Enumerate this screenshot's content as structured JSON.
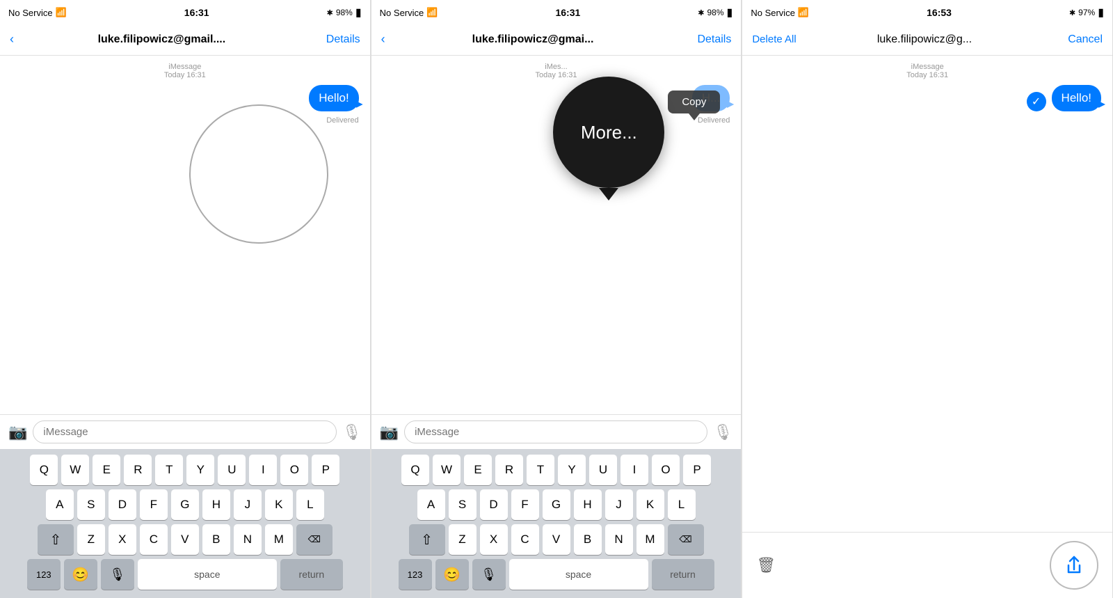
{
  "panels": [
    {
      "id": "panel1",
      "statusBar": {
        "left": "No Service",
        "wifiIcon": "📶",
        "center": "16:31",
        "bluetoothIcon": "🔷",
        "battery": "98%",
        "batteryIcon": "▮"
      },
      "navBar": {
        "backLabel": "‹",
        "titleLabel": "luke.filipowicz@gmail....",
        "actionLabel": "Details"
      },
      "messageArea": {
        "timestampLabel": "iMessage",
        "timestampSub": "Today 16:31",
        "bubbleText": "Hello!",
        "deliveredText": "Delivered"
      },
      "inputBar": {
        "placeholder": "iMessage"
      },
      "keyboard": {
        "rows": [
          [
            "Q",
            "W",
            "E",
            "R",
            "T",
            "Y",
            "U",
            "I",
            "O",
            "P"
          ],
          [
            "A",
            "S",
            "D",
            "F",
            "G",
            "H",
            "J",
            "K",
            "L"
          ],
          [
            "⇧",
            "Z",
            "X",
            "C",
            "V",
            "B",
            "N",
            "M",
            "⌫"
          ],
          [
            "123",
            "😊",
            "🎙",
            "space",
            "return"
          ]
        ]
      }
    },
    {
      "id": "panel2",
      "statusBar": {
        "left": "No Service",
        "wifiIcon": "📶",
        "center": "16:31",
        "bluetoothIcon": "🔷",
        "battery": "98%",
        "batteryIcon": "▮"
      },
      "navBar": {
        "backLabel": "‹",
        "titleLabel": "luke.filipowicz@gmai...",
        "actionLabel": "Details"
      },
      "messageArea": {
        "timestampLabel": "iMes...",
        "timestampSub": "Today 16:31",
        "bubbleText": "H...",
        "deliveredText": "Delivered"
      },
      "contextMenu": {
        "copyLabel": "Copy",
        "moreLabel": "More..."
      },
      "inputBar": {
        "placeholder": "iMessage"
      },
      "keyboard": {
        "rows": [
          [
            "Q",
            "W",
            "E",
            "R",
            "T",
            "Y",
            "U",
            "I",
            "O",
            "P"
          ],
          [
            "A",
            "S",
            "D",
            "F",
            "G",
            "H",
            "J",
            "K",
            "L"
          ],
          [
            "⇧",
            "Z",
            "X",
            "C",
            "V",
            "B",
            "N",
            "M",
            "⌫"
          ],
          [
            "123",
            "😊",
            "🎙",
            "space",
            "return"
          ]
        ]
      }
    },
    {
      "id": "panel3",
      "statusBar": {
        "left": "No Service",
        "wifiIcon": "📶",
        "center": "16:53",
        "bluetoothIcon": "🔷",
        "battery": "97%",
        "batteryIcon": "▮"
      },
      "navBar": {
        "deleteAllLabel": "Delete All",
        "titleLabel": "luke.filipowicz@g...",
        "cancelLabel": "Cancel"
      },
      "messageArea": {
        "timestampLabel": "iMessage",
        "timestampSub": "Today 16:31",
        "bubbleText": "Hello!",
        "deliveredText": ""
      },
      "bottomBar": {
        "trashLabel": "🗑",
        "shareLabel": "⇧"
      }
    }
  ]
}
